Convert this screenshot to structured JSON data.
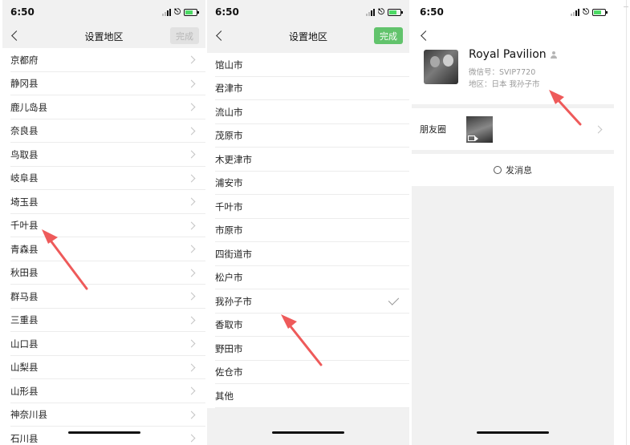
{
  "screens": [
    {
      "status": {
        "time": "6:50"
      },
      "nav": {
        "title": "设置地区",
        "done_label": "完成",
        "done_state": "disabled"
      },
      "items": [
        {
          "label": "京都府"
        },
        {
          "label": "静冈县"
        },
        {
          "label": "鹿儿岛县"
        },
        {
          "label": "奈良县"
        },
        {
          "label": "鸟取县"
        },
        {
          "label": "岐阜县"
        },
        {
          "label": "埼玉县"
        },
        {
          "label": "千叶县"
        },
        {
          "label": "青森县"
        },
        {
          "label": "秋田县"
        },
        {
          "label": "群马县"
        },
        {
          "label": "三重县"
        },
        {
          "label": "山口县"
        },
        {
          "label": "山梨县"
        },
        {
          "label": "山形县"
        },
        {
          "label": "神奈川县"
        },
        {
          "label": "石川县"
        }
      ]
    },
    {
      "status": {
        "time": "6:50"
      },
      "nav": {
        "title": "设置地区",
        "done_label": "完成",
        "done_state": "enabled"
      },
      "items": [
        {
          "label": "馆山市"
        },
        {
          "label": "君津市"
        },
        {
          "label": "流山市"
        },
        {
          "label": "茂原市"
        },
        {
          "label": "木更津市"
        },
        {
          "label": "浦安市"
        },
        {
          "label": "千叶市"
        },
        {
          "label": "市原市"
        },
        {
          "label": "四街道市"
        },
        {
          "label": "松户市"
        },
        {
          "label": "我孙子市",
          "selected": true
        },
        {
          "label": "香取市"
        },
        {
          "label": "野田市"
        },
        {
          "label": "佐仓市"
        },
        {
          "label": "其他"
        }
      ]
    },
    {
      "status": {
        "time": "6:50"
      },
      "profile": {
        "name": "Royal Pavilion",
        "wechat_id": "微信号：SVIP7720",
        "region": "地区：日本 我孙子市"
      },
      "moments_label": "朋友圈",
      "send_message_label": "发消息"
    }
  ],
  "colors": {
    "accent_green": "#62c36c",
    "annotation_red": "#ee5a5a"
  }
}
